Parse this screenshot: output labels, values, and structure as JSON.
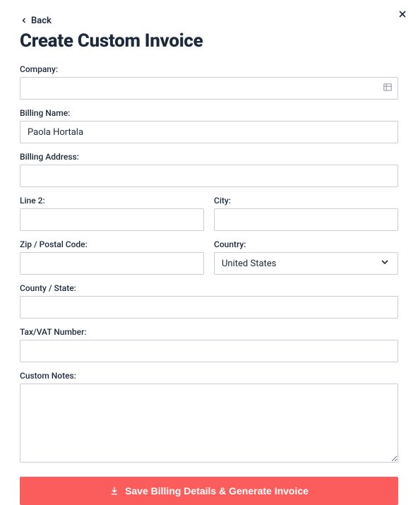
{
  "header": {
    "back_label": "Back",
    "title": "Create Custom Invoice"
  },
  "form": {
    "company": {
      "label": "Company:",
      "value": ""
    },
    "billing_name": {
      "label": "Billing Name:",
      "value": "Paola Hortala"
    },
    "billing_address": {
      "label": "Billing Address:",
      "value": ""
    },
    "line2": {
      "label": "Line 2:",
      "value": ""
    },
    "city": {
      "label": "City:",
      "value": ""
    },
    "zip": {
      "label": "Zip / Postal Code:",
      "value": ""
    },
    "country": {
      "label": "Country:",
      "value": "United States"
    },
    "county_state": {
      "label": "County / State:",
      "value": ""
    },
    "tax_vat": {
      "label": "Tax/VAT Number:",
      "value": ""
    },
    "custom_notes": {
      "label": "Custom Notes:",
      "value": ""
    }
  },
  "submit_label": "Save Billing Details & Generate Invoice"
}
